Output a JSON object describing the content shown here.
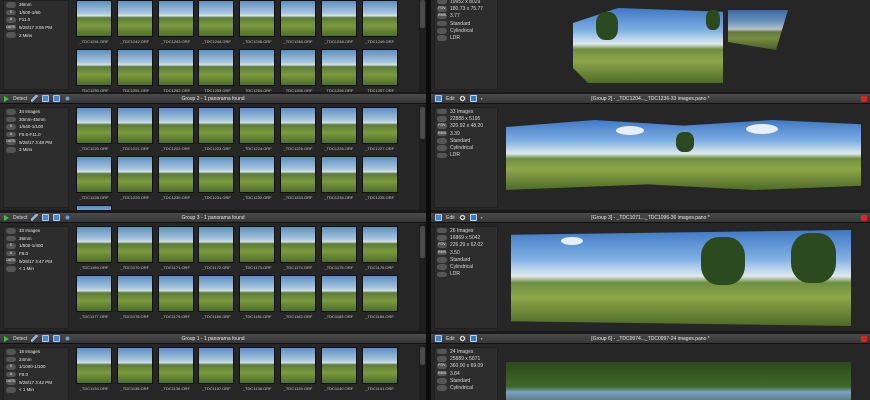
{
  "left_pane": {
    "detect_label": "Detect",
    "groups": [
      {
        "title": "",
        "info": [
          {
            "tag": "",
            "value": "36mm"
          },
          {
            "tag": "S",
            "value": "1/500-1/60"
          },
          {
            "tag": "A",
            "value": "F11.0"
          },
          {
            "tag": "DATE",
            "value": "9/28/17 3:55 PM"
          },
          {
            "tag": "",
            "value": "2 Mins"
          }
        ],
        "thumbs": [
          "_TDC1241.ORF",
          "_TDC1242.ORF",
          "_TDC1243.ORF",
          "_TDC1244.ORF",
          "_TDC1245.ORF",
          "_TDC1246.ORF",
          "_TDC1248.ORF",
          "_TDC1249.ORF",
          "_TDC1250.ORF",
          "_TDC1251.ORF",
          "_TDC1252.ORF",
          "_TDC1253.ORF",
          "_TDC1254.ORF",
          "_TDC1255.ORF",
          "_TDC1256.ORF",
          "_TDC1257.ORF"
        ]
      },
      {
        "title": "Group 2 - 1 panorama found",
        "info": [
          {
            "tag": "",
            "value": "34 Images"
          },
          {
            "tag": "",
            "value": "30mm-45mm"
          },
          {
            "tag": "S",
            "value": "1/640-1/100"
          },
          {
            "tag": "A",
            "value": "F5.6-F11.0"
          },
          {
            "tag": "DATE",
            "value": "9/28/17 3:48 PM"
          },
          {
            "tag": "",
            "value": "3 Mins"
          }
        ],
        "thumbs": [
          "_TDC1220.ORF",
          "_TDC1221.ORF",
          "_TDC1222.ORF",
          "_TDC1223.ORF",
          "_TDC1224.ORF",
          "_TDC1225.ORF",
          "_TDC1226.ORF",
          "_TDC1227.ORF",
          "_TDC1228.ORF",
          "_TDC1229.ORF",
          "_TDC1230.ORF",
          "_TDC1231.ORF",
          "_TDC1232.ORF",
          "_TDC1233.ORF",
          "_TDC1234.ORF",
          "_TDC1235.ORF",
          "_TDC1236.ORF"
        ]
      },
      {
        "title": "Group 3 - 1 panorama found",
        "info": [
          {
            "tag": "",
            "value": "33 Images"
          },
          {
            "tag": "",
            "value": "36mm"
          },
          {
            "tag": "S",
            "value": "1/500-1/400"
          },
          {
            "tag": "A",
            "value": "F8.0"
          },
          {
            "tag": "DATE",
            "value": "9/28/17 3:47 PM"
          },
          {
            "tag": "",
            "value": "< 1 Min"
          }
        ],
        "thumbs": [
          "_TDC1169.ORF",
          "_TDC1170.ORF",
          "_TDC1171.ORF",
          "_TDC1172.ORF",
          "_TDC1173.ORF",
          "_TDC1174.ORF",
          "_TDC1175.ORF",
          "_TDC1176.ORF",
          "_TDC1177.ORF",
          "_TDC1178.ORF",
          "_TDC1179.ORF",
          "_TDC1180.ORF",
          "_TDC1181.ORF",
          "_TDC1182.ORF",
          "_TDC1183.ORF",
          "_TDC1184.ORF"
        ]
      },
      {
        "title": "Group 1 - 1 panorama found",
        "info": [
          {
            "tag": "",
            "value": "16 Images"
          },
          {
            "tag": "",
            "value": "24mm"
          },
          {
            "tag": "S",
            "value": "1/1000-1/100"
          },
          {
            "tag": "A",
            "value": "F8.0"
          },
          {
            "tag": "DATE",
            "value": "9/28/17 3:42 PM"
          },
          {
            "tag": "",
            "value": "< 1 Min"
          }
        ],
        "thumbs": [
          "_TDC1134.ORF",
          "_TDC1135.ORF",
          "_TDC1136.ORF",
          "_TDC1137.ORF",
          "_TDC1138.ORF",
          "_TDC1139.ORF",
          "_TDC1140.ORF",
          "_TDC1141.ORF"
        ]
      }
    ]
  },
  "right_pane": {
    "edit_label": "Edit",
    "panos": [
      {
        "title": "",
        "info": [
          {
            "tag": "",
            "value": "19952 x 8029"
          },
          {
            "tag": "FOV",
            "value": "180.73 x 75.77"
          },
          {
            "tag": "RMS",
            "value": "3.77"
          },
          {
            "tag": "",
            "value": "Standard"
          },
          {
            "tag": "",
            "value": "Cylindrical"
          },
          {
            "tag": "",
            "value": "LDR"
          }
        ]
      },
      {
        "title": "[Group 2] - _TDC1204..._TDC1236-33 images.pano *",
        "info": [
          {
            "tag": "",
            "value": "33 Images"
          },
          {
            "tag": "",
            "value": "22888 x 5195"
          },
          {
            "tag": "FOV",
            "value": "320.92 x 48.20"
          },
          {
            "tag": "RMS",
            "value": "3.39"
          },
          {
            "tag": "",
            "value": "Standard"
          },
          {
            "tag": "",
            "value": "Cylindrical"
          },
          {
            "tag": "",
            "value": "LDR"
          }
        ]
      },
      {
        "title": "[Group 3] - _TDC1071..._TDC1096-36 images.pano *",
        "info": [
          {
            "tag": "",
            "value": "26 Images"
          },
          {
            "tag": "",
            "value": "16869 x 5042"
          },
          {
            "tag": "FOV",
            "value": "226.29 x 62.02"
          },
          {
            "tag": "RMS",
            "value": "3.50"
          },
          {
            "tag": "",
            "value": "Standard"
          },
          {
            "tag": "",
            "value": "Cylindrical"
          },
          {
            "tag": "",
            "value": "LDR"
          }
        ]
      },
      {
        "title": "[Group 6] - _TDC0974..._TDC0997-24 images.pano *",
        "info": [
          {
            "tag": "",
            "value": "24 Images"
          },
          {
            "tag": "",
            "value": "25889 x 5871"
          },
          {
            "tag": "FOV",
            "value": "360.00 x 69.09"
          },
          {
            "tag": "RMS",
            "value": "3.84"
          },
          {
            "tag": "",
            "value": "Standard"
          },
          {
            "tag": "",
            "value": "Cylindrical"
          }
        ]
      }
    ]
  }
}
